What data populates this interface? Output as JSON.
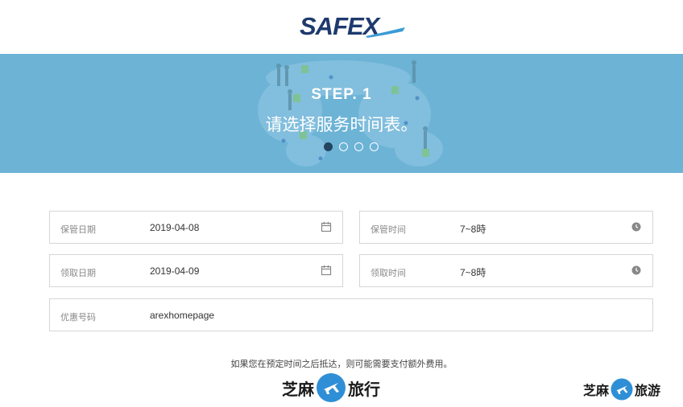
{
  "header": {
    "logo_text": "SAFEX",
    "brand_color": "#1e3a6e",
    "accent_color": "#3a9bd5"
  },
  "banner": {
    "background_color": "#6cb3d6",
    "step_title": "STEP. 1",
    "step_subtitle": "请选择服务时间表。",
    "carousel": {
      "total": 4,
      "active_index": 0
    }
  },
  "form": {
    "storage_date": {
      "label": "保管日期",
      "value": "2019-04-08",
      "icon": "calendar-icon"
    },
    "storage_time": {
      "label": "保管时间",
      "value": "7~8時",
      "icon": "clock-icon"
    },
    "pickup_date": {
      "label": "领取日期",
      "value": "2019-04-09",
      "icon": "calendar-icon"
    },
    "pickup_time": {
      "label": "领取时间",
      "value": "7~8時",
      "icon": "clock-icon"
    },
    "coupon": {
      "label": "优惠号码",
      "value": "arexhomepage"
    }
  },
  "notice": "如果您在预定时间之后抵达，则可能需要支付额外费用。",
  "watermark": {
    "left_text": "芝麻",
    "right_text_1": "旅行",
    "right_text_2": "旅游",
    "icon": "airplane-icon"
  }
}
